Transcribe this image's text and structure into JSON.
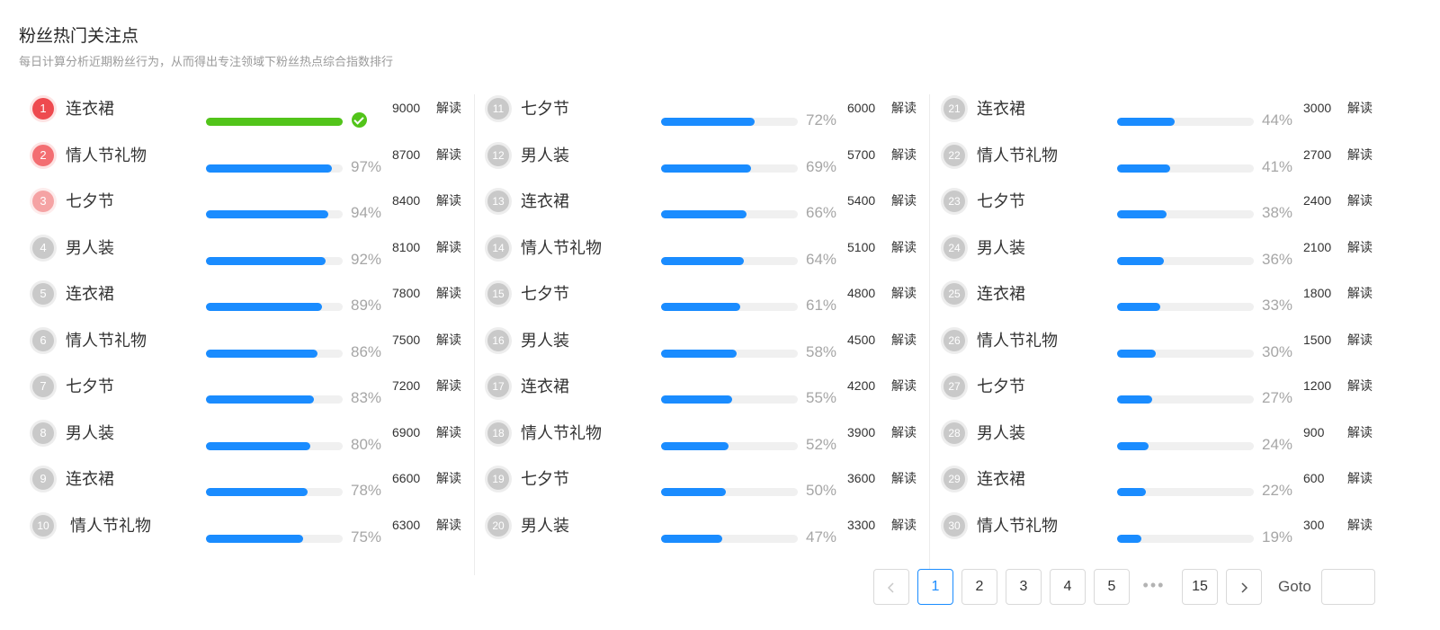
{
  "header": {
    "title": "粉丝热门关注点",
    "subtitle": "每日计算分析近期粉丝行为，从而得出专注领域下粉丝热点综合指数排行"
  },
  "action_label": "解读",
  "colors": {
    "accent": "#1a8cff",
    "complete": "#52c41a",
    "rank1": "#ee4a4f",
    "rank2": "#f36e72",
    "rank3": "#f5a3a4",
    "rank_default": "#c9c9c9"
  },
  "items": [
    {
      "rank": "1",
      "name": "连衣裙",
      "progress": 100,
      "percent_label": "",
      "complete": true,
      "value": "9000"
    },
    {
      "rank": "2",
      "name": "情人节礼物",
      "progress": 97,
      "percent_label": "97%",
      "value": "8700"
    },
    {
      "rank": "3",
      "name": "七夕节",
      "progress": 94,
      "percent_label": "94%",
      "value": "8400"
    },
    {
      "rank": "4",
      "name": "男人装",
      "progress": 92,
      "percent_label": "92%",
      "value": "8100"
    },
    {
      "rank": "5",
      "name": "连衣裙",
      "progress": 89,
      "percent_label": "89%",
      "value": "7800"
    },
    {
      "rank": "6",
      "name": "情人节礼物",
      "progress": 86,
      "percent_label": "86%",
      "value": "7500"
    },
    {
      "rank": "7",
      "name": "七夕节",
      "progress": 83,
      "percent_label": "83%",
      "value": "7200"
    },
    {
      "rank": "8",
      "name": "男人装",
      "progress": 80,
      "percent_label": "80%",
      "value": "6900"
    },
    {
      "rank": "9",
      "name": "连衣裙",
      "progress": 78,
      "percent_label": "78%",
      "value": "6600"
    },
    {
      "rank": "10",
      "name": "情人节礼物",
      "progress": 75,
      "percent_label": "75%",
      "value": "6300"
    },
    {
      "rank": "11",
      "name": "七夕节",
      "progress": 72,
      "percent_label": "72%",
      "value": "6000"
    },
    {
      "rank": "12",
      "name": "男人装",
      "progress": 69,
      "percent_label": "69%",
      "value": "5700"
    },
    {
      "rank": "13",
      "name": "连衣裙",
      "progress": 66,
      "percent_label": "66%",
      "value": "5400"
    },
    {
      "rank": "14",
      "name": "情人节礼物",
      "progress": 64,
      "percent_label": "64%",
      "value": "5100"
    },
    {
      "rank": "15",
      "name": "七夕节",
      "progress": 61,
      "percent_label": "61%",
      "value": "4800"
    },
    {
      "rank": "16",
      "name": "男人装",
      "progress": 58,
      "percent_label": "58%",
      "value": "4500"
    },
    {
      "rank": "17",
      "name": "连衣裙",
      "progress": 55,
      "percent_label": "55%",
      "value": "4200"
    },
    {
      "rank": "18",
      "name": "情人节礼物",
      "progress": 52,
      "percent_label": "52%",
      "value": "3900"
    },
    {
      "rank": "19",
      "name": "七夕节",
      "progress": 50,
      "percent_label": "50%",
      "value": "3600"
    },
    {
      "rank": "20",
      "name": "男人装",
      "progress": 47,
      "percent_label": "47%",
      "value": "3300"
    },
    {
      "rank": "21",
      "name": "连衣裙",
      "progress": 44,
      "percent_label": "44%",
      "value": "3000"
    },
    {
      "rank": "22",
      "name": "情人节礼物",
      "progress": 41,
      "percent_label": "41%",
      "value": "2700"
    },
    {
      "rank": "23",
      "name": "七夕节",
      "progress": 38,
      "percent_label": "38%",
      "value": "2400"
    },
    {
      "rank": "24",
      "name": "男人装",
      "progress": 36,
      "percent_label": "36%",
      "value": "2100"
    },
    {
      "rank": "25",
      "name": "连衣裙",
      "progress": 33,
      "percent_label": "33%",
      "value": "1800"
    },
    {
      "rank": "26",
      "name": "情人节礼物",
      "progress": 30,
      "percent_label": "30%",
      "value": "1500"
    },
    {
      "rank": "27",
      "name": "七夕节",
      "progress": 27,
      "percent_label": "27%",
      "value": "1200"
    },
    {
      "rank": "28",
      "name": "男人装",
      "progress": 24,
      "percent_label": "24%",
      "value": "900"
    },
    {
      "rank": "29",
      "name": "连衣裙",
      "progress": 22,
      "percent_label": "22%",
      "value": "600"
    },
    {
      "rank": "30",
      "name": "情人节礼物",
      "progress": 19,
      "percent_label": "19%",
      "value": "300"
    }
  ],
  "pagination": {
    "prev_icon": "chevron-left-icon",
    "next_icon": "chevron-right-icon",
    "pages": [
      "1",
      "2",
      "3",
      "4",
      "5"
    ],
    "current_page": "1",
    "ellipsis": "•••",
    "last_page": "15",
    "goto_label": "Goto",
    "goto_value": ""
  }
}
